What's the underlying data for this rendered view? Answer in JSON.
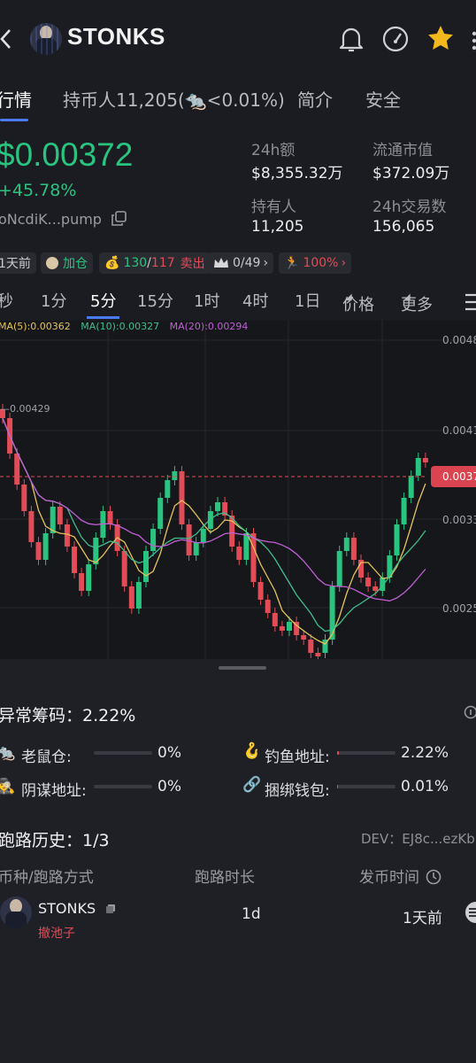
{
  "header": {
    "title": "STONKS"
  },
  "tabs": [
    {
      "label": "行情"
    },
    {
      "label": "持币人11,205(🐀<0.01%)"
    },
    {
      "label": "简介"
    },
    {
      "label": "安全"
    }
  ],
  "token": {
    "price": "$0.00372",
    "change": "+45.78%",
    "address": "oNcdiK...pump"
  },
  "stats": {
    "vol_label": "24h额",
    "vol_value": "$8,355.32万",
    "mcap_label": "流通市值",
    "mcap_value": "$372.09万",
    "holders_label": "持有人",
    "holders_value": "11,205",
    "tx_label": "24h交易数",
    "tx_value": "156,065"
  },
  "tags": {
    "age": "1天前",
    "add": "加仓",
    "buy": "130",
    "sep": "/",
    "sell_count": "117",
    "sell": "卖出",
    "crown": "0/49",
    "run": "100%"
  },
  "intervals": [
    "秒",
    "1分",
    "5分",
    "15分",
    "1时",
    "4时",
    "1日",
    "价格",
    "更多"
  ],
  "chart_labels": {
    "ma5": "MA(5):0.00362",
    "ma10": "MA(10):0.00327",
    "ma20": "MA(20):0.00294",
    "high": "0.00429",
    "y1": "0.0048",
    "y2": "0.0041",
    "y3": "0.0033",
    "y4": "0.0025",
    "cur": "0.0037"
  },
  "colors": {
    "up": "#29c47f",
    "down": "#e24c57",
    "ma5": "#e7c35a",
    "ma10": "#3fbf8c",
    "ma20": "#c15fd6"
  },
  "anomaly": {
    "title": "异常筹码：2.22%",
    "rat_label": "老鼠仓:",
    "rat_value": "0%",
    "phish_label": "钓鱼地址:",
    "phish_value": "2.22%",
    "plot_label": "阴谋地址:",
    "plot_value": "0%",
    "bundle_label": "捆绑钱包:",
    "bundle_value": "0.01%",
    "phish_fraction": 0.0222,
    "bundle_fraction": 0.0001
  },
  "rug": {
    "title": "跑路历史：1/3",
    "dev": "DEV：EJ8c...ezKb",
    "col1": "币种/跑路方式",
    "col2": "跑路时长",
    "col3": "发币时间",
    "row": {
      "name": "STONKS",
      "method": "撤池子",
      "duration": "1d",
      "launched": "1天前"
    }
  }
}
